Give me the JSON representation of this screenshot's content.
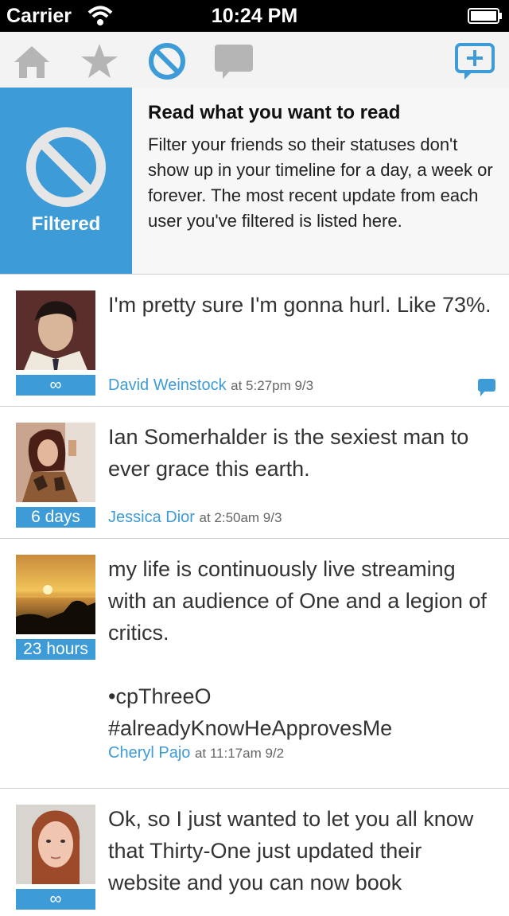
{
  "status_bar": {
    "carrier": "Carrier",
    "time": "10:24 PM"
  },
  "toolbar": {
    "icons": [
      "home-icon",
      "star-icon",
      "filter-icon",
      "chat-icon",
      "compose-icon"
    ],
    "active_color": "#3d9bd8"
  },
  "header": {
    "panel_label": "Filtered",
    "title": "Read what you want to read",
    "body": "Filter your friends so their statuses don't show up in your timeline for a day, a week or forever. The most recent update from each user you've filtered is listed here."
  },
  "feed": [
    {
      "text": "I'm pretty sure I'm gonna hurl. Like 73%.",
      "badge": "∞",
      "name": "David Weinstock",
      "at": "at 5:27pm 9/3"
    },
    {
      "text": "Ian Somerhalder is the sexiest man to ever grace this earth.",
      "badge": "6 days",
      "name": "Jessica Dior",
      "at": "at 2:50am 9/3"
    },
    {
      "text": "my life is continuously live streaming with an audience of One and a legion of critics.\n\n•cpThreeO\n#alreadyKnowHeApprovesMe",
      "badge": "23 hours",
      "name": "Cheryl Pajo",
      "at": "at 11:17am 9/2"
    },
    {
      "text": "Ok, so I just wanted to let you all know that Thirty-One just updated their website and you can now book",
      "badge": "∞",
      "name": "",
      "at": ""
    }
  ],
  "colors": {
    "accent": "#3d9bd8",
    "toolbar_bg": "#f3f3f3",
    "inactive_icon": "#b5b5b5"
  }
}
